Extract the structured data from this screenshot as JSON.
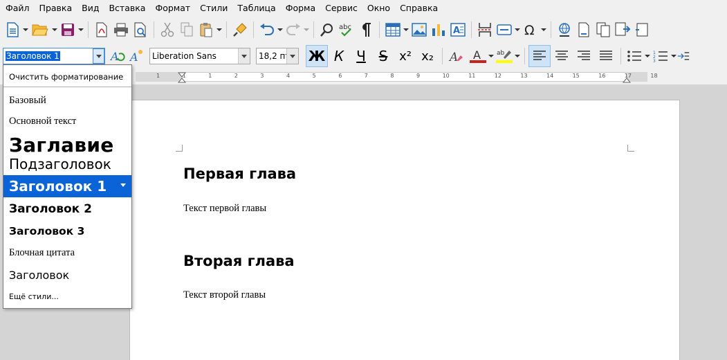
{
  "menu": [
    "Файл",
    "Правка",
    "Вид",
    "Вставка",
    "Формат",
    "Стили",
    "Таблица",
    "Форма",
    "Сервис",
    "Окно",
    "Справка"
  ],
  "formatting": {
    "paragraph_style": "Заголовок 1",
    "font_name": "Liberation Sans",
    "font_size": "18,2 пт",
    "bold_glyph": "Ж",
    "italic_glyph": "К",
    "underline_glyph": "Ч",
    "strike_glyph": "S",
    "superscript_glyph": "x²",
    "subscript_glyph": "x₂",
    "font_color": "#c9211e",
    "highlight_color": "#ffff00"
  },
  "ruler": {
    "numbers": [
      "1",
      "1",
      "1",
      "2",
      "3",
      "4",
      "5",
      "6",
      "7",
      "8",
      "9",
      "10",
      "11",
      "12",
      "13",
      "14",
      "15",
      "16",
      "17",
      "18"
    ]
  },
  "style_list": {
    "clear": "Очистить форматирование",
    "items": [
      {
        "label": "Базовый"
      },
      {
        "label": "Основной текст"
      },
      {
        "label": "Заглавие"
      },
      {
        "label": "Подзаголовок"
      },
      {
        "label": "Заголовок 1"
      },
      {
        "label": "Заголовок 2"
      },
      {
        "label": "Заголовок 3"
      },
      {
        "label": "Блочная цитата"
      },
      {
        "label": "Заголовок"
      }
    ],
    "more": "Ещё стили..."
  },
  "document": {
    "heading1": "Первая глава",
    "text1": "Текст первой главы",
    "heading2": "Вторая глава",
    "text2": "Текст второй главы"
  }
}
